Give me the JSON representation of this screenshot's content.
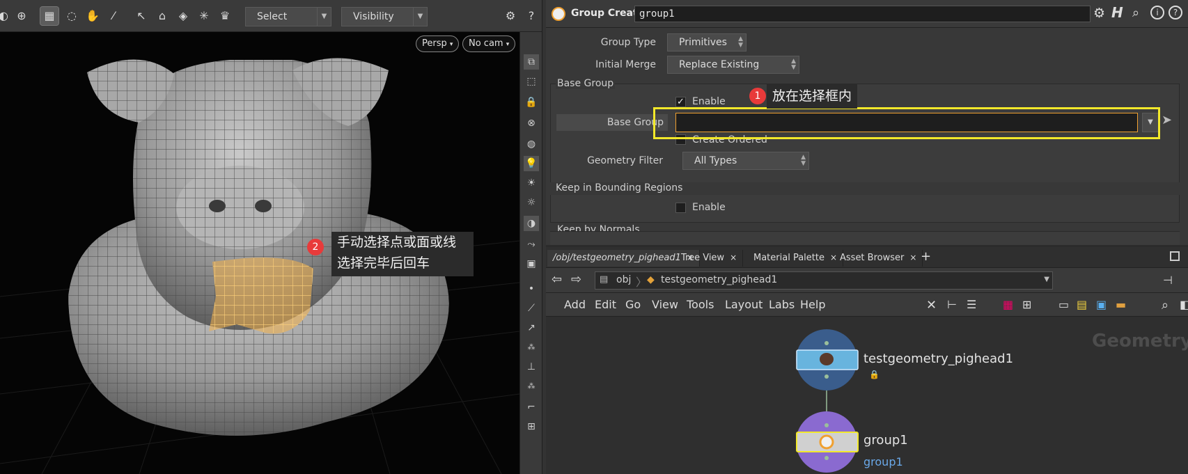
{
  "toolbar": {
    "select_label": "Select",
    "visibility_label": "Visibility"
  },
  "viewport": {
    "persp_label": "Persp",
    "cam_label": "No cam"
  },
  "annotations": {
    "a1_number": "1",
    "a1_text": "放在选择框内",
    "a2_number": "2",
    "a2_line1": "手动选择点或面或线",
    "a2_line2": "选择完毕后回车"
  },
  "params": {
    "node_type": "Group Create",
    "node_name": "group1",
    "group_type_label": "Group Type",
    "group_type_value": "Primitives",
    "initial_merge_label": "Initial Merge",
    "initial_merge_value": "Replace Existing",
    "base_group_section": "Base Group",
    "enable_label": "Enable",
    "base_group_label": "Base Group",
    "base_group_value": "",
    "create_ordered_label": "Create Ordered",
    "geometry_filter_label": "Geometry Filter",
    "geometry_filter_value": "All Types",
    "keep_bounding_section": "Keep in Bounding Regions",
    "keep_bounding_enable": "Enable",
    "keep_normals_section": "Keep by Normals"
  },
  "network": {
    "tabs": [
      {
        "label": "/obj/testgeometry_pighead1"
      },
      {
        "label": "Tree View"
      },
      {
        "label": "Material Palette"
      },
      {
        "label": "Asset Browser"
      }
    ],
    "path_obj": "obj",
    "path_node": "testgeometry_pighead1",
    "menu": [
      "Add",
      "Edit",
      "Go",
      "View",
      "Tools",
      "Layout",
      "Labs",
      "Help"
    ],
    "watermark": "Geometry",
    "nodes": [
      {
        "name": "testgeometry_pighead1"
      },
      {
        "name": "group1",
        "sublabel": "group1"
      }
    ]
  },
  "colors": {
    "highlight_box": "#f2e82a",
    "badge": "#e83a3a",
    "selection": "#f3b14a",
    "node_ring_blue": "#3a5d8c",
    "node_ring_purple": "#8a6ad0"
  }
}
